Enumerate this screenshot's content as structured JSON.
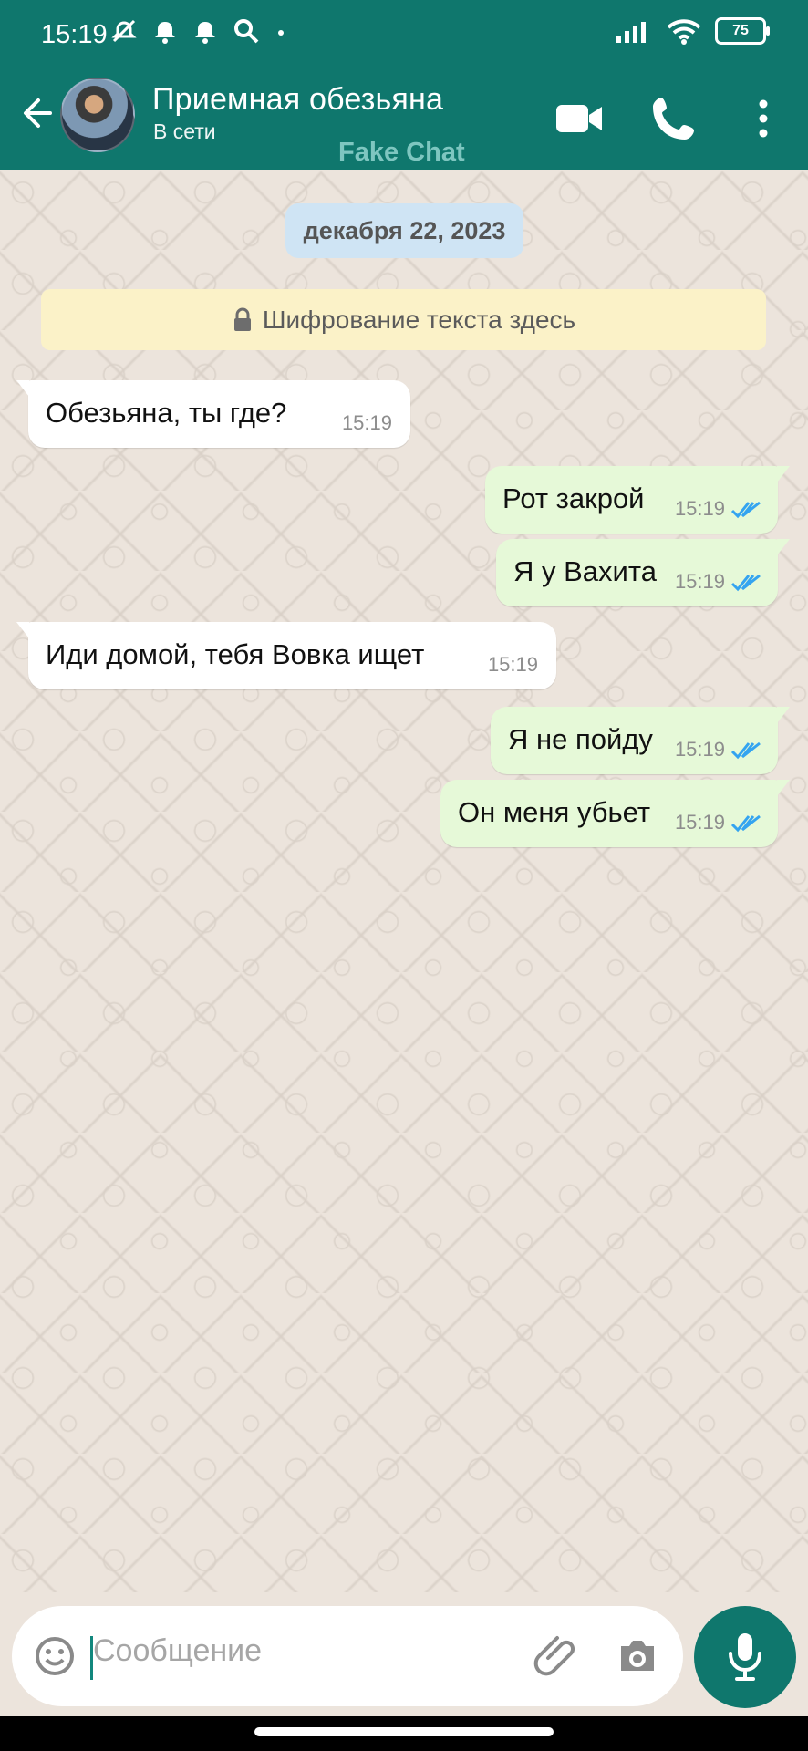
{
  "status_bar": {
    "time": "15:19",
    "battery": "75"
  },
  "header": {
    "contact_name": "Приемная обезьяна",
    "contact_status": "В сети",
    "watermark": "Fake Chat",
    "accent": "#0f776d"
  },
  "chat": {
    "date": "декабря 22, 2023",
    "encryption": "Шифрование текста здесь",
    "messages": [
      {
        "direction": "incoming",
        "text": "Обезьяна, ты где?",
        "time": "15:19"
      },
      {
        "direction": "outgoing",
        "text": "Рот закрой",
        "time": "15:19",
        "status": "read"
      },
      {
        "direction": "outgoing",
        "text": "Я у Вахита",
        "time": "15:19",
        "status": "read"
      },
      {
        "direction": "incoming",
        "text": "Иди домой, тебя Вовка ищет",
        "time": "15:19"
      },
      {
        "direction": "outgoing",
        "text": "Я не пойду",
        "time": "15:19",
        "status": "read"
      },
      {
        "direction": "outgoing",
        "text": "Он меня убьет",
        "time": "15:19",
        "status": "read"
      }
    ]
  },
  "composer": {
    "placeholder": "Сообщение"
  },
  "icons": {
    "back": "arrow-left-icon",
    "video": "video-camera-icon",
    "call": "phone-icon",
    "menu": "more-vertical-icon",
    "emoji": "emoji-icon",
    "attach": "paperclip-icon",
    "camera": "camera-icon",
    "mic": "microphone-icon"
  }
}
